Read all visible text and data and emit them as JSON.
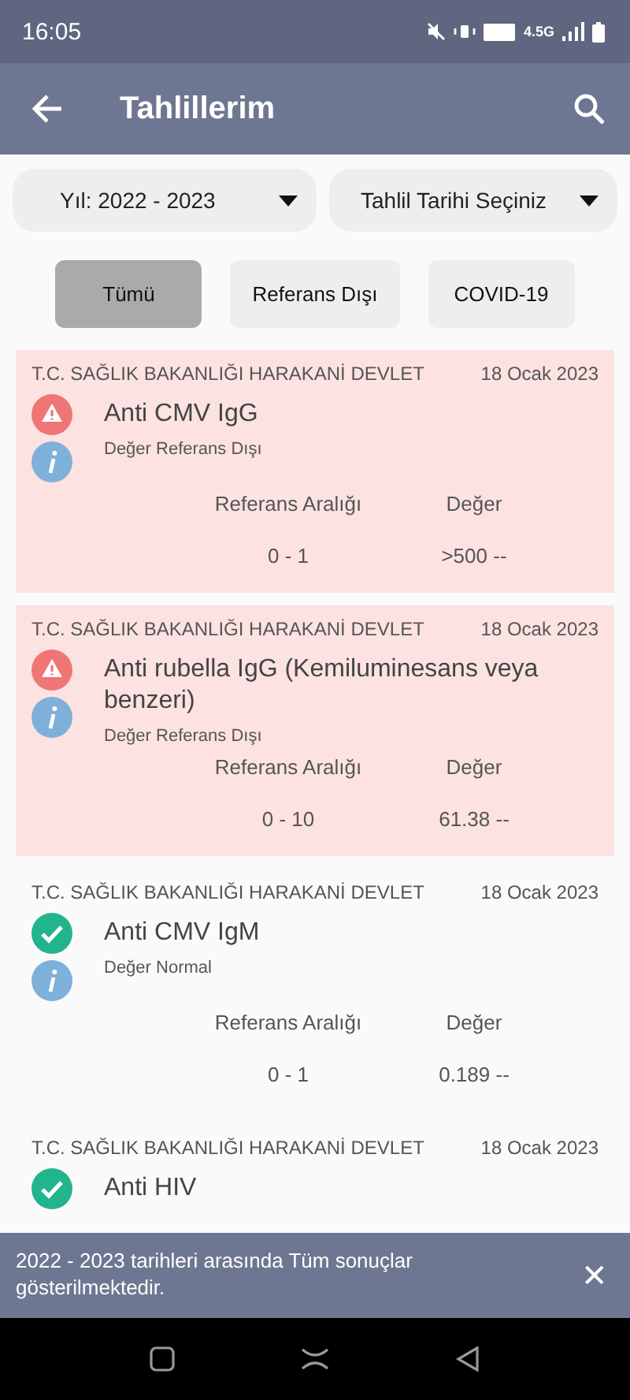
{
  "status_bar": {
    "time": "16:05",
    "network": "4.5G"
  },
  "app_bar": {
    "title": "Tahlillerim"
  },
  "filters": {
    "year": "Yıl: 2022 - 2023",
    "date": "Tahlil Tarihi Seçiniz"
  },
  "chips": [
    {
      "label": "Tümü",
      "selected": true
    },
    {
      "label": "Referans Dışı",
      "selected": false
    },
    {
      "label": "COVID-19",
      "selected": false
    }
  ],
  "results": [
    {
      "kind": "abnormal",
      "institution": "T.C. SAĞLIK BAKANLIĞI HARAKANİ DEVLET",
      "date": "18 Ocak 2023",
      "test": "Anti CMV IgG",
      "note": "Değer Referans Dışı",
      "range_label": "Referans Aralığı",
      "value_label": "Değer",
      "range": "0 - 1",
      "value": ">500 --"
    },
    {
      "kind": "abnormal",
      "institution": "T.C. SAĞLIK BAKANLIĞI HARAKANİ DEVLET",
      "date": "18 Ocak 2023",
      "test": "Anti rubella IgG (Kemiluminesans veya benzeri)",
      "note": "Değer Referans Dışı",
      "range_label": "Referans Aralığı",
      "value_label": "Değer",
      "range": "0 - 10",
      "value": "61.38 --"
    },
    {
      "kind": "normal",
      "institution": "T.C. SAĞLIK BAKANLIĞI HARAKANİ DEVLET",
      "date": "18 Ocak 2023",
      "test": "Anti CMV IgM",
      "note": "Değer Normal",
      "range_label": "Referans Aralığı",
      "value_label": "Değer",
      "range": "0 - 1",
      "value": "0.189 --"
    },
    {
      "kind": "normal",
      "institution": "T.C. SAĞLIK BAKANLIĞI HARAKANİ DEVLET",
      "date": "18 Ocak 2023",
      "test": "Anti HIV"
    }
  ],
  "snackbar": {
    "message": "2022 - 2023 tarihleri arasında Tüm sonuçlar gösterilmektedir.",
    "close": "✕"
  }
}
